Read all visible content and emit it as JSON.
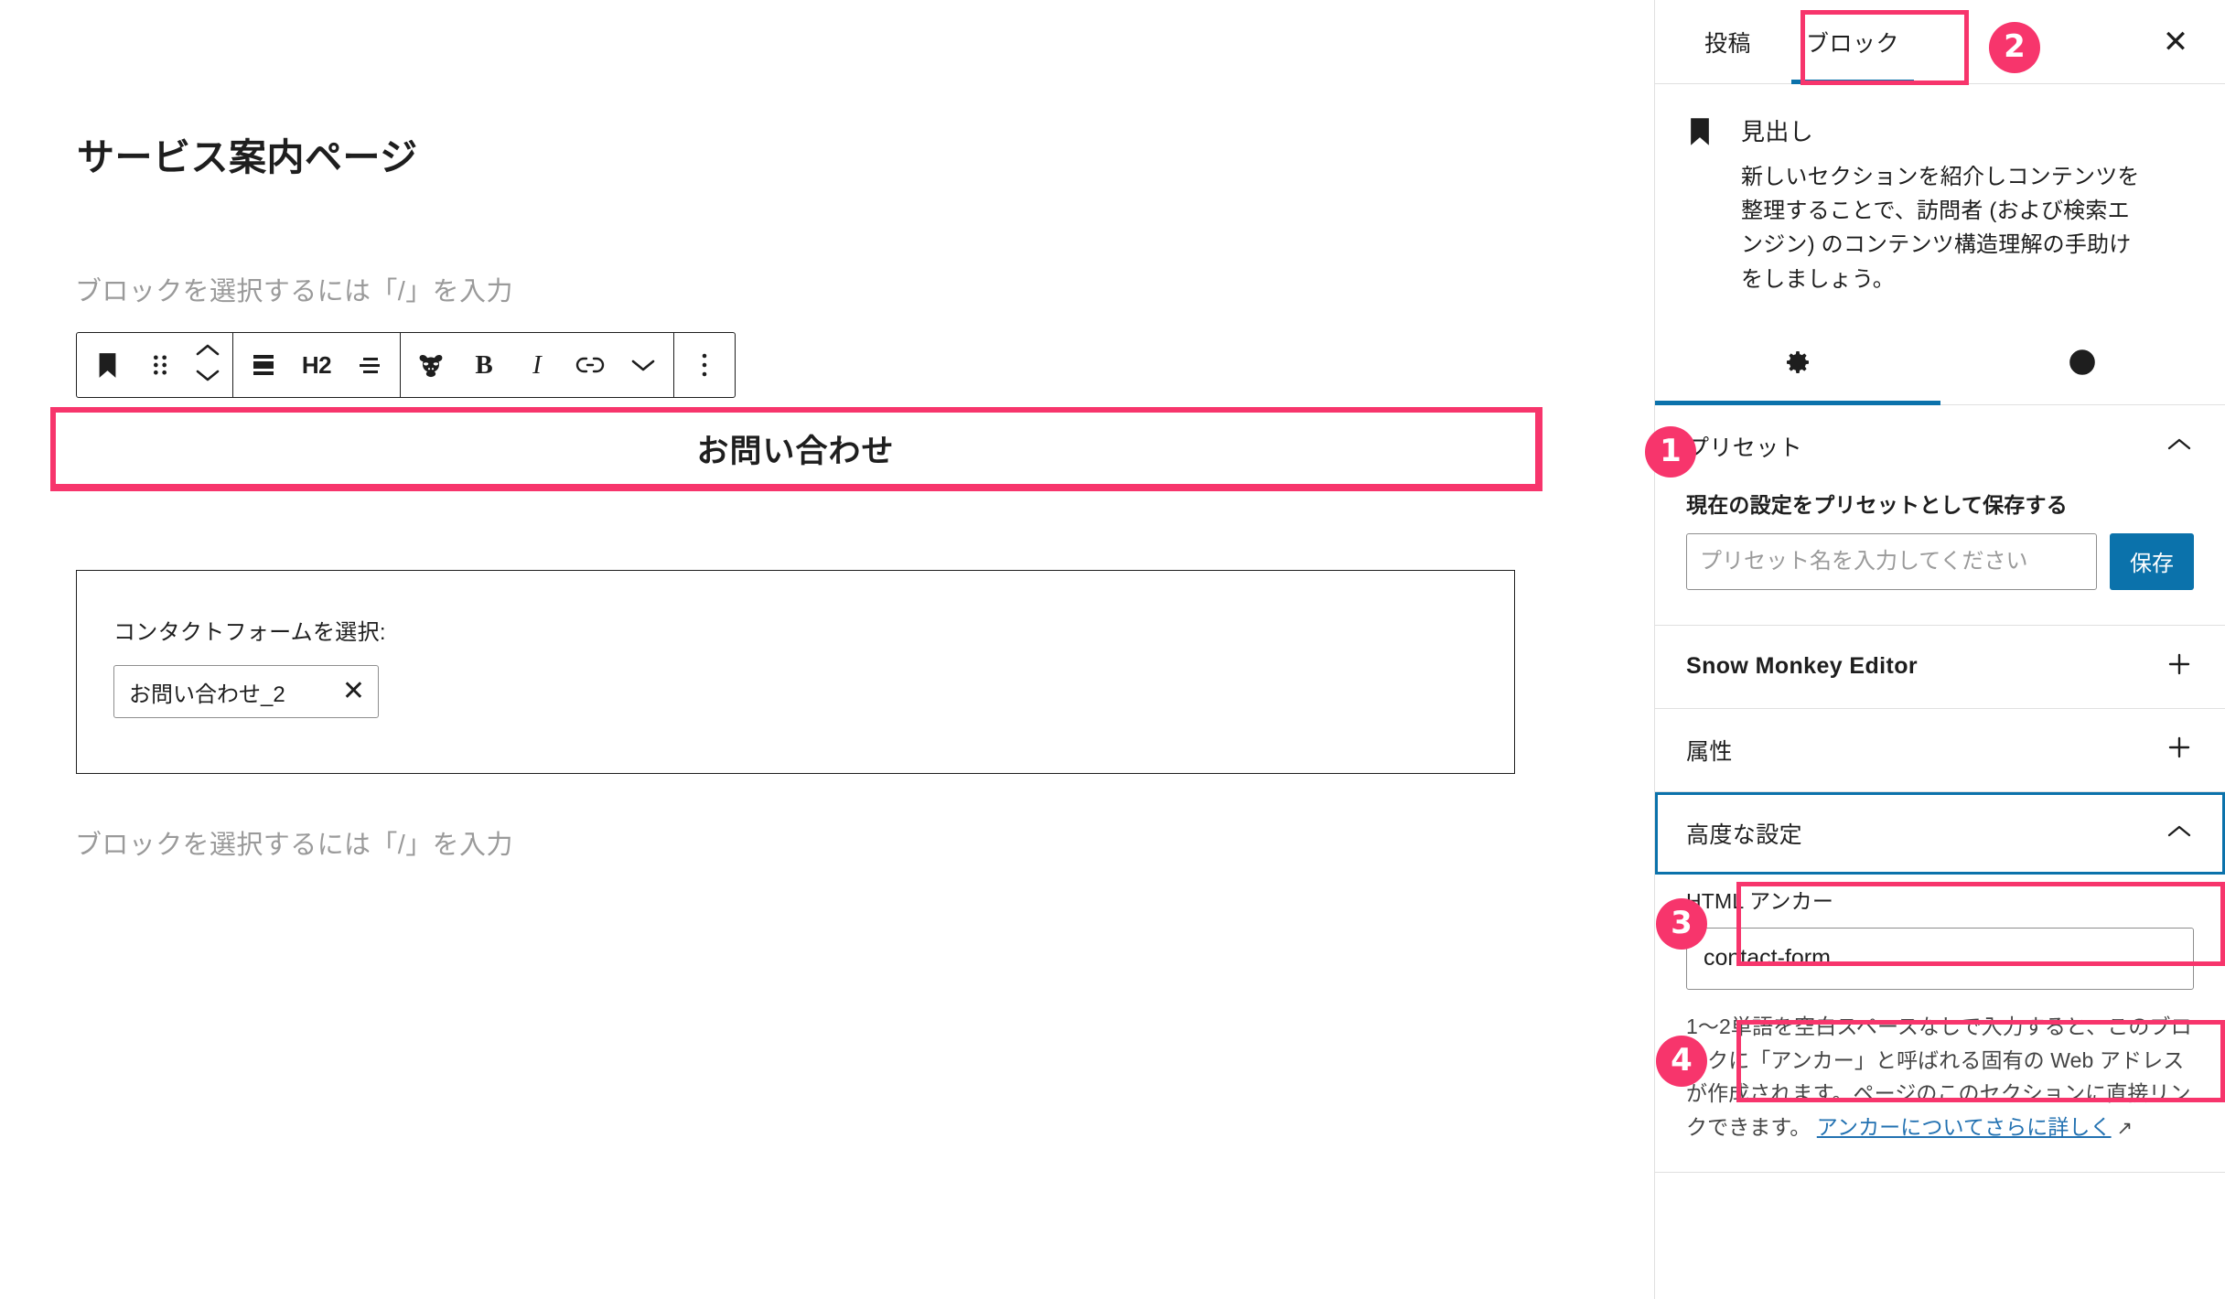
{
  "editor": {
    "document_title": "サービス案内ページ",
    "placeholder_top": "ブロックを選択するには「/」を入力",
    "placeholder_bottom": "ブロックを選択するには「/」を入力",
    "heading_block_text": "お問い合わせ",
    "toolbar": {
      "block_type_icon": "heading-bookmark-icon",
      "drag_handle_icon": "drag-handle-icon",
      "move_up_icon": "chevron-up-icon",
      "move_down_icon": "chevron-down-icon",
      "align_icon": "align-block-icon",
      "heading_level_label": "H2",
      "text_align_icon": "text-align-icon",
      "snow_monkey_icon": "snow-monkey-logo-icon",
      "bold_label": "B",
      "italic_label": "I",
      "link_icon": "link-icon",
      "more_rich_text_icon": "chevron-down-icon",
      "options_icon": "more-options-vertical-icon"
    },
    "contact_form_block": {
      "label": "コンタクトフォームを選択:",
      "selected_value": "お問い合わせ_2",
      "clear_icon": "close-x-icon"
    }
  },
  "sidebar": {
    "tabs": [
      {
        "label": "投稿",
        "active": false
      },
      {
        "label": "ブロック",
        "active": true
      }
    ],
    "close_icon": "close-x-icon",
    "block_card": {
      "icon": "heading-bookmark-icon",
      "title": "見出し",
      "description": "新しいセクションを紹介しコンテンツを整理することで、訪問者 (および検索エンジン) のコンテンツ構造理解の手助けをしましょう。"
    },
    "subtabs": [
      {
        "icon": "gear-icon",
        "name": "settings-tab",
        "active": true
      },
      {
        "icon": "contrast-half-circle-icon",
        "name": "styles-tab",
        "active": false
      }
    ],
    "panels": [
      {
        "title": "プリセット",
        "toggle_icon": "chevron-up-icon",
        "expanded": true,
        "field_label": "現在の設定をプリセットとして保存する",
        "input_placeholder": "プリセット名を入力してください",
        "input_value": "",
        "save_label": "保存"
      },
      {
        "title": "Snow Monkey Editor",
        "toggle_icon": "plus-icon",
        "expanded": false
      },
      {
        "title": "属性",
        "toggle_icon": "plus-icon",
        "expanded": false
      }
    ],
    "advanced": {
      "title": "高度な設定",
      "toggle_icon": "chevron-up-icon",
      "anchor_label": "HTML アンカー",
      "anchor_value": "contact-form",
      "help_text": "1〜2単語を空白スペースなしで入力すると、このブロックに「アンカー」と呼ばれる固有の Web アドレスが作成されます。ページのこのセクションに直接リンクできます。 ",
      "help_link_text": "アンカーについてさらに詳しく",
      "help_link_icon": "external-link-arrow-icon"
    }
  },
  "annotations": {
    "badges": [
      {
        "number": "1",
        "target": "heading-block"
      },
      {
        "number": "2",
        "target": "block-tab"
      },
      {
        "number": "3",
        "target": "advanced-settings-panel-header"
      },
      {
        "number": "4",
        "target": "html-anchor-input"
      }
    ],
    "highlight_color": "#f7356c",
    "accent_color": "#0b72ab"
  }
}
